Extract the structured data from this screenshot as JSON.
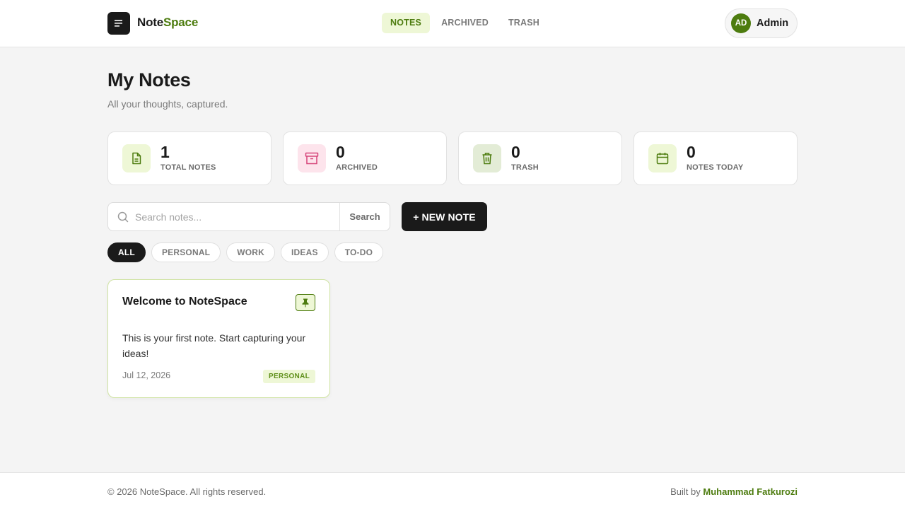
{
  "header": {
    "brand_part1": "Note",
    "brand_part2": "Space",
    "nav": [
      {
        "label": "NOTES",
        "active": true
      },
      {
        "label": "ARCHIVED",
        "active": false
      },
      {
        "label": "TRASH",
        "active": false
      }
    ],
    "user": {
      "initials": "AD",
      "name": "Admin"
    }
  },
  "page": {
    "title": "My Notes",
    "subtitle": "All your thoughts, captured."
  },
  "stats": [
    {
      "value": "1",
      "label": "TOTAL NOTES",
      "icon": "document-icon",
      "color": "#eef7d6"
    },
    {
      "value": "0",
      "label": "ARCHIVED",
      "icon": "archive-icon",
      "color": "#fde4ec"
    },
    {
      "value": "0",
      "label": "TRASH",
      "icon": "trash-icon",
      "color": "#e3ecd6"
    },
    {
      "value": "0",
      "label": "NOTES TODAY",
      "icon": "calendar-icon",
      "color": "#eef7d6"
    }
  ],
  "search": {
    "placeholder": "Search notes...",
    "value": "",
    "button_label": "Search"
  },
  "new_note_label": "+ NEW NOTE",
  "filters": [
    {
      "label": "ALL",
      "active": true
    },
    {
      "label": "PERSONAL",
      "active": false
    },
    {
      "label": "WORK",
      "active": false
    },
    {
      "label": "IDEAS",
      "active": false
    },
    {
      "label": "TO-DO",
      "active": false
    }
  ],
  "notes": [
    {
      "title": "Welcome to NoteSpace",
      "body": "This is your first note. Start capturing your ideas!",
      "date": "Jul 12, 2026",
      "tag": "PERSONAL",
      "pinned": true
    }
  ],
  "footer": {
    "copyright": "© 2026 NoteSpace. All rights reserved.",
    "built_by_prefix": "Built by ",
    "author": "Muhammad Fatkurozi"
  },
  "colors": {
    "accent": "#4d7c0f",
    "accent_soft": "#eef7d6",
    "dark": "#1a1a1a",
    "background": "#f4f4f4"
  }
}
